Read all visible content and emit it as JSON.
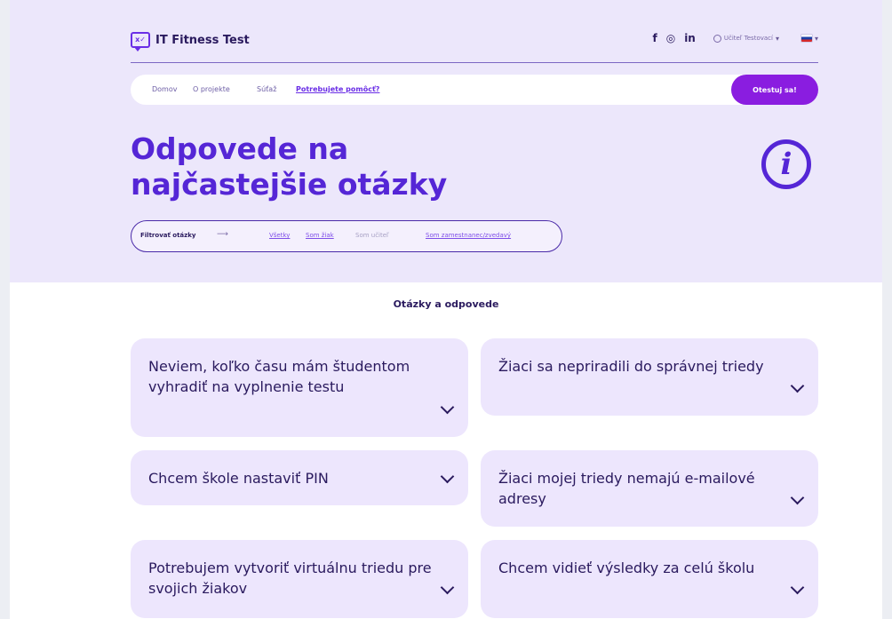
{
  "header": {
    "logo_mark": "x✓",
    "logo_text": "IT Fitness Test",
    "social": [
      "f",
      "◎",
      "in"
    ],
    "user_label": "Učiteľ Testovací",
    "caret": "▾"
  },
  "nav": {
    "items": [
      "Domov",
      "O projekte",
      "Súťaž",
      "Potrebujete pomôcť?"
    ],
    "cta": "Otestuj sa!"
  },
  "hero": {
    "title_line1": "Odpovede na",
    "title_line2": "najčastejšie otázky",
    "info_glyph": "i"
  },
  "filter": {
    "label": "Filtrovať otázky",
    "arrow": "⟶",
    "options": [
      "Všetky",
      "Som žiak",
      "Som učiteľ",
      "Som zamestnanec/zvedavý"
    ]
  },
  "faq": {
    "title": "Otázky a odpovede",
    "items": [
      "Neviem, koľko času mám študentom vyhradiť na vyplnenie testu",
      "Žiaci sa nepriradili do správnej triedy",
      "Chcem škole nastaviť PIN",
      "Žiaci mojej triedy nemajú e-mailové adresy",
      "Potrebujem vytvoriť virtuálnu triedu pre svojich žiakov",
      "Chcem vidieť výsledky za celú školu"
    ]
  },
  "colors": {
    "hero_bg": "#ece7fb",
    "accent": "#5526d6",
    "cta": "#8a1de0",
    "card_bg": "#ede6fd",
    "text": "#2a1a5e"
  }
}
